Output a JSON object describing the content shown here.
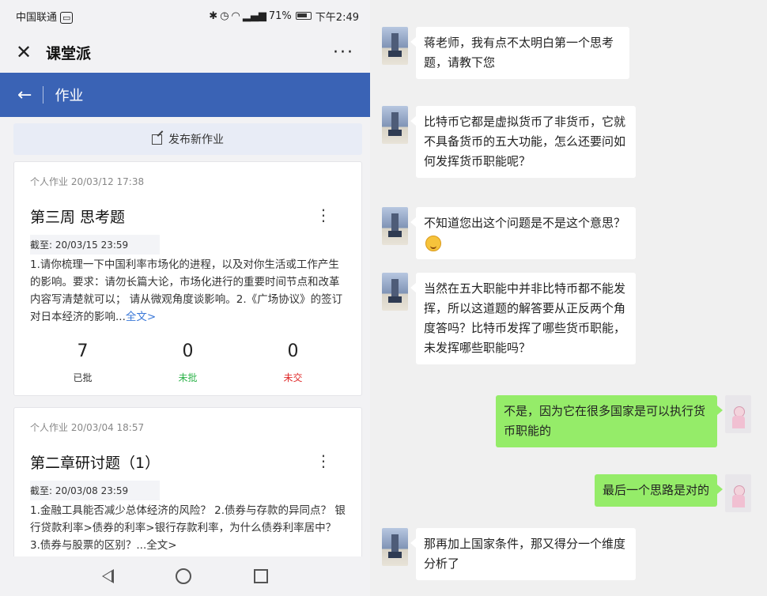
{
  "status_bar": {
    "carrier": "中国联通",
    "battery_pct": "71%",
    "time": "下午2:49"
  },
  "app": {
    "title": "课堂派",
    "section": "作业",
    "publish_label": "发布新作业"
  },
  "cards": [
    {
      "meta": "个人作业  20/03/12 17:38",
      "title": "第三周 思考题",
      "deadline": "截至: 20/03/15 23:59",
      "desc": "1.请你梳理一下中国利率市场化的进程，以及对你生活或工作产生的影响。要求：请勿长篇大论，市场化进行的重要时间节点和改革内容写清楚就可以；  请从微观角度谈影响。2.《广场协议》的签订对日本经济的影响...",
      "more": "全文>",
      "stats": [
        {
          "num": "7",
          "label": "已批",
          "color": "#333333"
        },
        {
          "num": "0",
          "label": "未批",
          "color": "#2db34a"
        },
        {
          "num": "0",
          "label": "未交",
          "color": "#e02b2b"
        }
      ]
    },
    {
      "meta": "个人作业  20/03/04 18:57",
      "title": "第二章研讨题（1）",
      "deadline": "截至: 20/03/08 23:59",
      "desc": "1.金融工具能否减少总体经济的风险？ 2.债券与存款的异同点？  银行贷款利率>债券的利率>银行存款利率，为什么债券利率居中？ 3.债券与股票的区别？...全文>"
    }
  ],
  "chat": [
    {
      "from": "teacher-contact",
      "text": "蒋老师，我有点不太明白第一个思考题，请教下您"
    },
    {
      "from": "teacher-contact",
      "text": "比特币它都是虚拟货币了非货币，它就不具备货币的五大功能，怎么还要问如何发挥货币职能呢？"
    },
    {
      "from": "teacher-contact",
      "text": "不知道您出这个问题是不是这个意思？",
      "emoji": "face-emoji-icon"
    },
    {
      "from": "teacher-contact",
      "text": "当然在五大职能中并非比特币都不能发挥，所以这道题的解答要从正反两个角度答吗？比特币发挥了哪些货币职能，未发挥哪些职能吗？"
    },
    {
      "from": "self",
      "text": "不是，因为它在很多国家是可以执行货币职能的"
    },
    {
      "from": "self",
      "text": "最后一个思路是对的"
    },
    {
      "from": "teacher-contact",
      "text": "那再加上国家条件，那又得分一个维度分析了"
    }
  ]
}
